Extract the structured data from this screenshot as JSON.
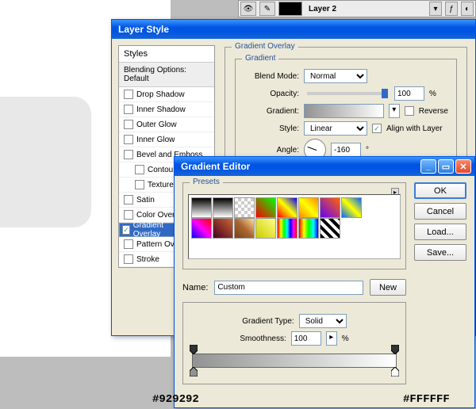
{
  "layers_bar": {
    "layer_name": "Layer 2"
  },
  "layer_style": {
    "title": "Layer Style",
    "styles_header": "Styles",
    "blending_options": "Blending Options: Default",
    "items": [
      {
        "label": "Drop Shadow",
        "checked": false
      },
      {
        "label": "Inner Shadow",
        "checked": false
      },
      {
        "label": "Outer Glow",
        "checked": false
      },
      {
        "label": "Inner Glow",
        "checked": false
      },
      {
        "label": "Bevel and Emboss",
        "checked": false
      },
      {
        "label": "Contour",
        "checked": false,
        "indent": true
      },
      {
        "label": "Texture",
        "checked": false,
        "indent": true
      },
      {
        "label": "Satin",
        "checked": false
      },
      {
        "label": "Color Overlay",
        "checked": false
      },
      {
        "label": "Gradient Overlay",
        "checked": true,
        "selected": true
      },
      {
        "label": "Pattern Overlay",
        "checked": false
      },
      {
        "label": "Stroke",
        "checked": false
      }
    ],
    "section_title": "Gradient Overlay",
    "subsection_title": "Gradient",
    "blend_mode_label": "Blend Mode:",
    "blend_mode_value": "Normal",
    "opacity_label": "Opacity:",
    "opacity_value": "100",
    "opacity_unit": "%",
    "gradient_label": "Gradient:",
    "reverse_label": "Reverse",
    "reverse_checked": false,
    "style_label": "Style:",
    "style_value": "Linear",
    "align_label": "Align with Layer",
    "align_checked": true,
    "angle_label": "Angle:",
    "angle_value": "-160",
    "angle_unit": "°"
  },
  "gradient_editor": {
    "title": "Gradient Editor",
    "presets_label": "Presets",
    "ok": "OK",
    "cancel": "Cancel",
    "load": "Load...",
    "save": "Save...",
    "name_label": "Name:",
    "name_value": "Custom",
    "new": "New",
    "type_label": "Gradient Type:",
    "type_value": "Solid",
    "smoothness_label": "Smoothness:",
    "smoothness_value": "100",
    "smoothness_unit": "%",
    "stops": {
      "left": "#929292",
      "right": "#FFFFFF"
    }
  },
  "callouts": {
    "left": "#929292",
    "right": "#FFFFFF"
  }
}
